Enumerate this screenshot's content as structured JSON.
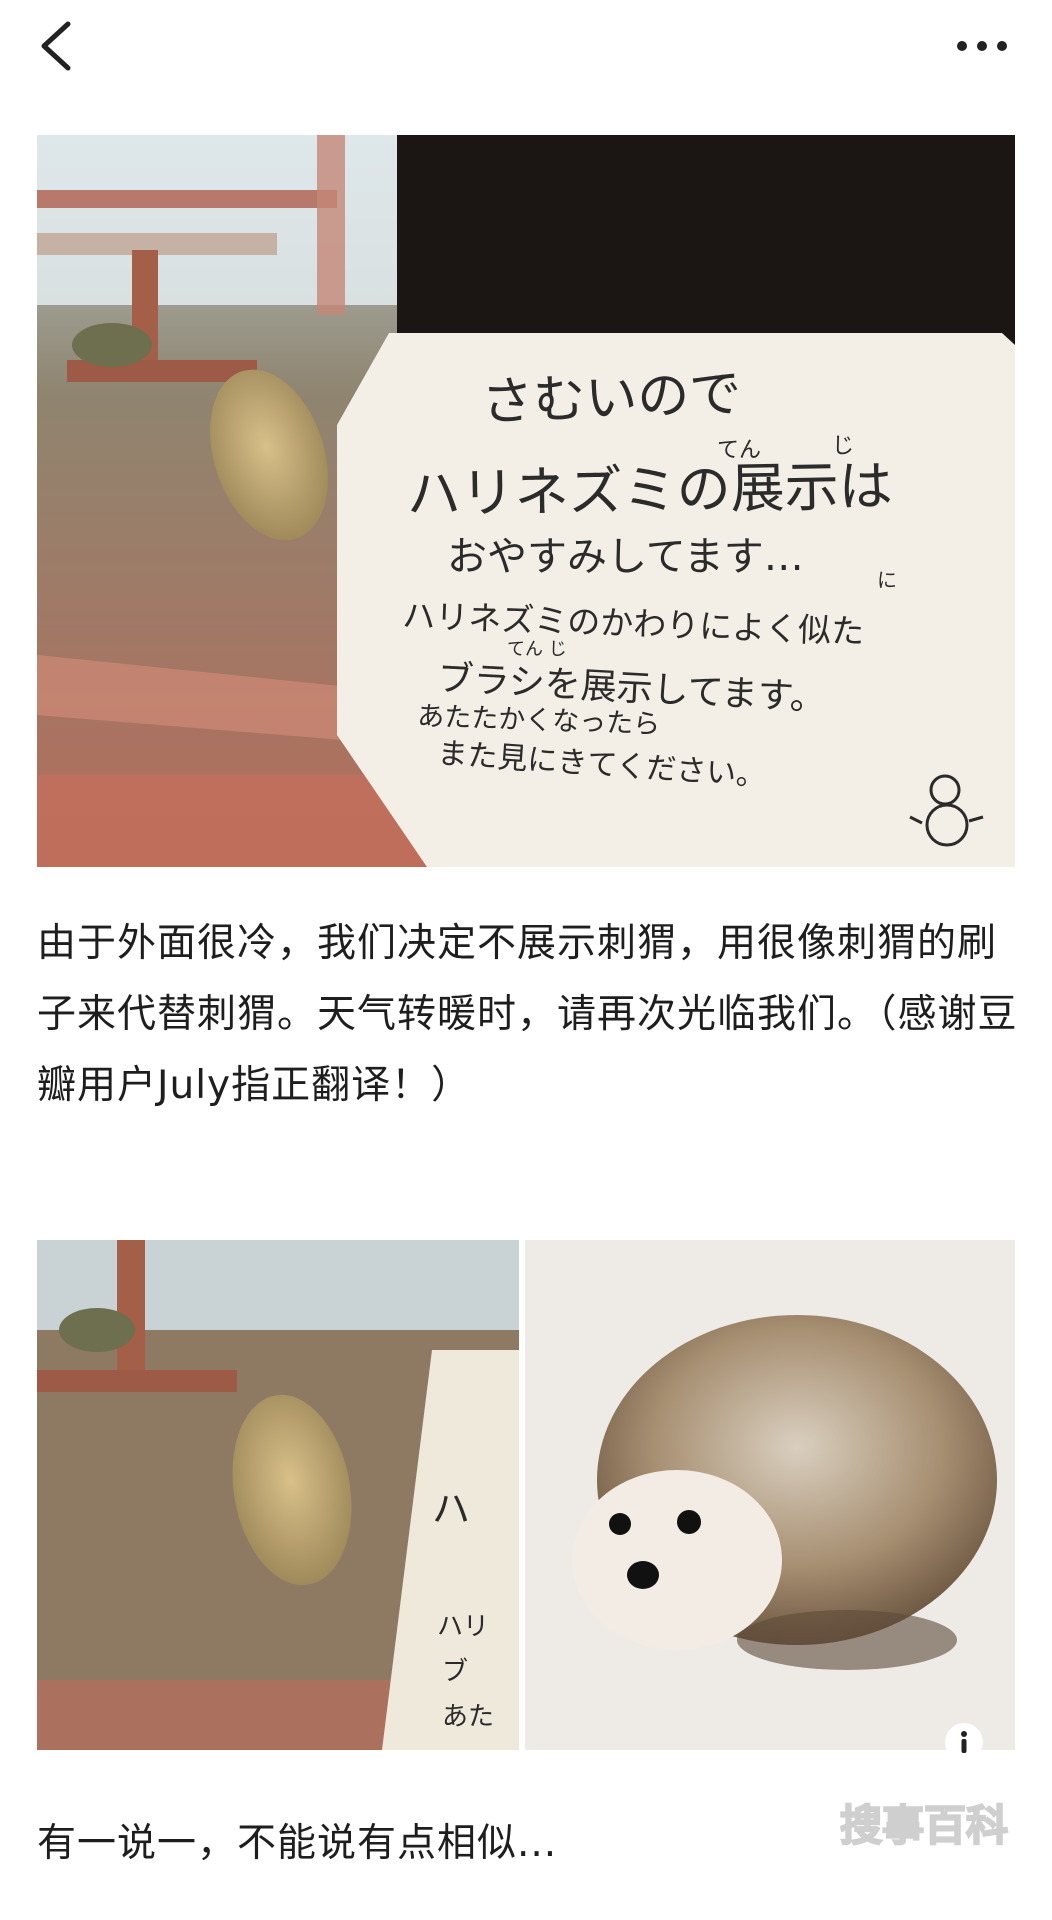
{
  "nav": {
    "back_icon": "chevron-left-icon",
    "more_icon": "more-horizontal-icon"
  },
  "image1": {
    "sign_lines": [
      "さむいので",
      "ハリネズミの展示は",
      "おやすみしてます…",
      "ハリネズミのかわりによく似た",
      "ブラシを展示してます。",
      "あたたかくなったら",
      "また見にきてください。"
    ],
    "furigana": [
      "てん",
      "じ",
      "に",
      "てん じ"
    ]
  },
  "article": {
    "paragraph1": "由于外面很冷，我们决定不展示刺猬，用很像刺猬的刷子来代替刺猬。天气转暖时，请再次光临我们。（感谢豆瓣用户July指正翻译！）",
    "paragraph2": "有一说一，不能说有点相似..."
  },
  "image2": {
    "sign_fragments": [
      "ハ",
      "ハリ",
      "ブ",
      "あた"
    ],
    "info_icon": "info-icon"
  },
  "watermark": {
    "text": "搜事百科"
  },
  "colors": {
    "text": "#1e1e1e",
    "sign_ink": "#2b2b2b",
    "sign_board": "#f3efe6",
    "brush": "#c4a872"
  }
}
